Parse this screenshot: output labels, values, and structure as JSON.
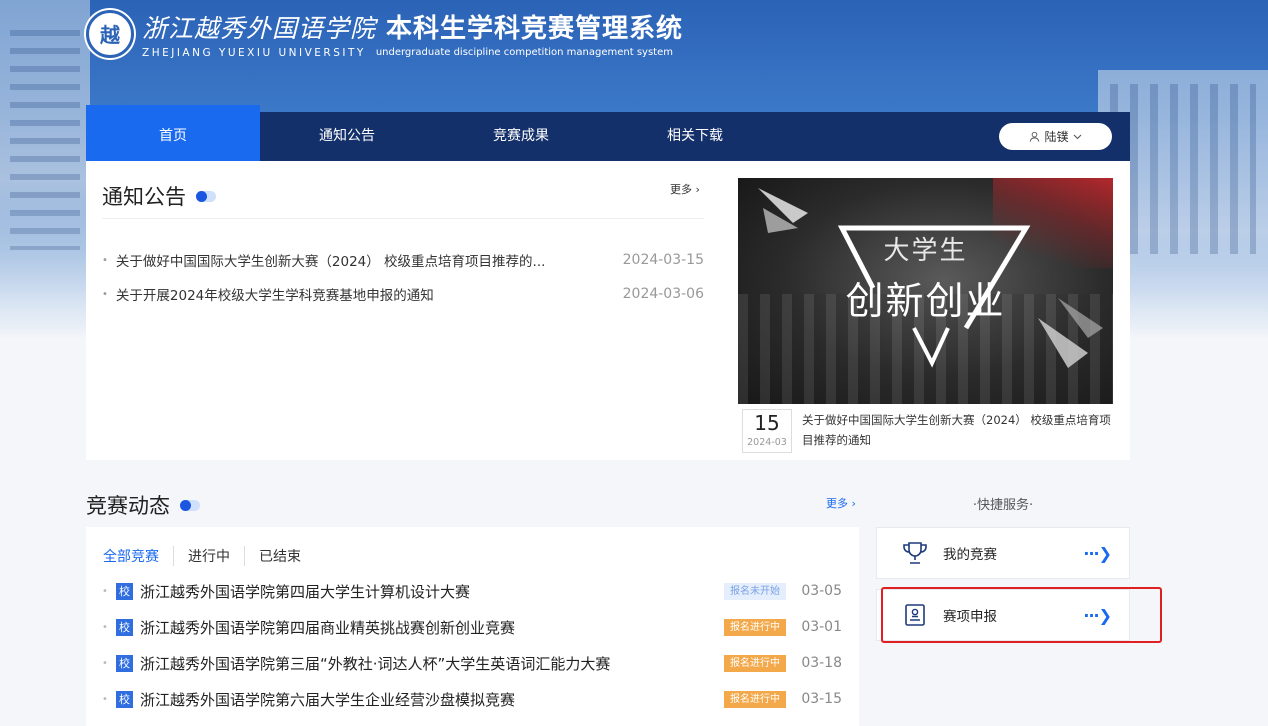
{
  "header": {
    "logo_badge": "越",
    "school_cn": "浙江越秀外国语学院",
    "system_cn": "本科生学科竞赛管理系统",
    "school_en": "ZHEJIANG YUEXIU UNIVERSITY",
    "system_en": "undergraduate discipline competition management system"
  },
  "nav": {
    "items": [
      {
        "label": "首页",
        "active": true
      },
      {
        "label": "通知公告",
        "active": false
      },
      {
        "label": "竞赛成果",
        "active": false
      },
      {
        "label": "相关下载",
        "active": false
      }
    ],
    "user_name": "陆镤"
  },
  "notices": {
    "title": "通知公告",
    "more": "更多",
    "items": [
      {
        "title": "关于做好中国国际大学生创新大赛（2024） 校级重点培育项目推荐的...",
        "date": "2024-03-15"
      },
      {
        "title": "关于开展2024年校级大学生学科竞赛基地申报的通知",
        "date": "2024-03-06"
      }
    ],
    "feature": {
      "image_line1": "大学生",
      "image_line2": "创新创业",
      "day": "15",
      "year_month": "2024-03",
      "caption": "关于做好中国国际大学生创新大赛（2024） 校级重点培育项目推荐的通知"
    }
  },
  "competitions": {
    "title": "竞赛动态",
    "more": "更多",
    "tabs": [
      "全部竞赛",
      "进行中",
      "已结束"
    ],
    "tag": "校",
    "items": [
      {
        "name": "浙江越秀外国语学院第四届大学生计算机设计大赛",
        "status": "报名未开始",
        "status_type": "notstart",
        "date": "03-05"
      },
      {
        "name": "浙江越秀外国语学院第四届商业精英挑战赛创新创业竞赛",
        "status": "报名进行中",
        "status_type": "ongoing",
        "date": "03-01"
      },
      {
        "name": "浙江越秀外国语学院第三届“外教社·词达人杯”大学生英语词汇能力大赛",
        "status": "报名进行中",
        "status_type": "ongoing",
        "date": "03-18"
      },
      {
        "name": "浙江越秀外国语学院第六届大学生企业经营沙盘模拟竞赛",
        "status": "报名进行中",
        "status_type": "ongoing",
        "date": "03-15"
      }
    ]
  },
  "quick_services": {
    "title": "·快捷服务·",
    "items": [
      {
        "label": "我的竞赛",
        "icon": "trophy-icon"
      },
      {
        "label": "赛项申报",
        "icon": "apply-icon"
      }
    ]
  },
  "colors": {
    "nav_bg": "#14306b",
    "nav_active": "#1a6af0",
    "accent": "#1a6af0",
    "status_ongoing": "#f3a84a",
    "highlight": "#e02020"
  }
}
